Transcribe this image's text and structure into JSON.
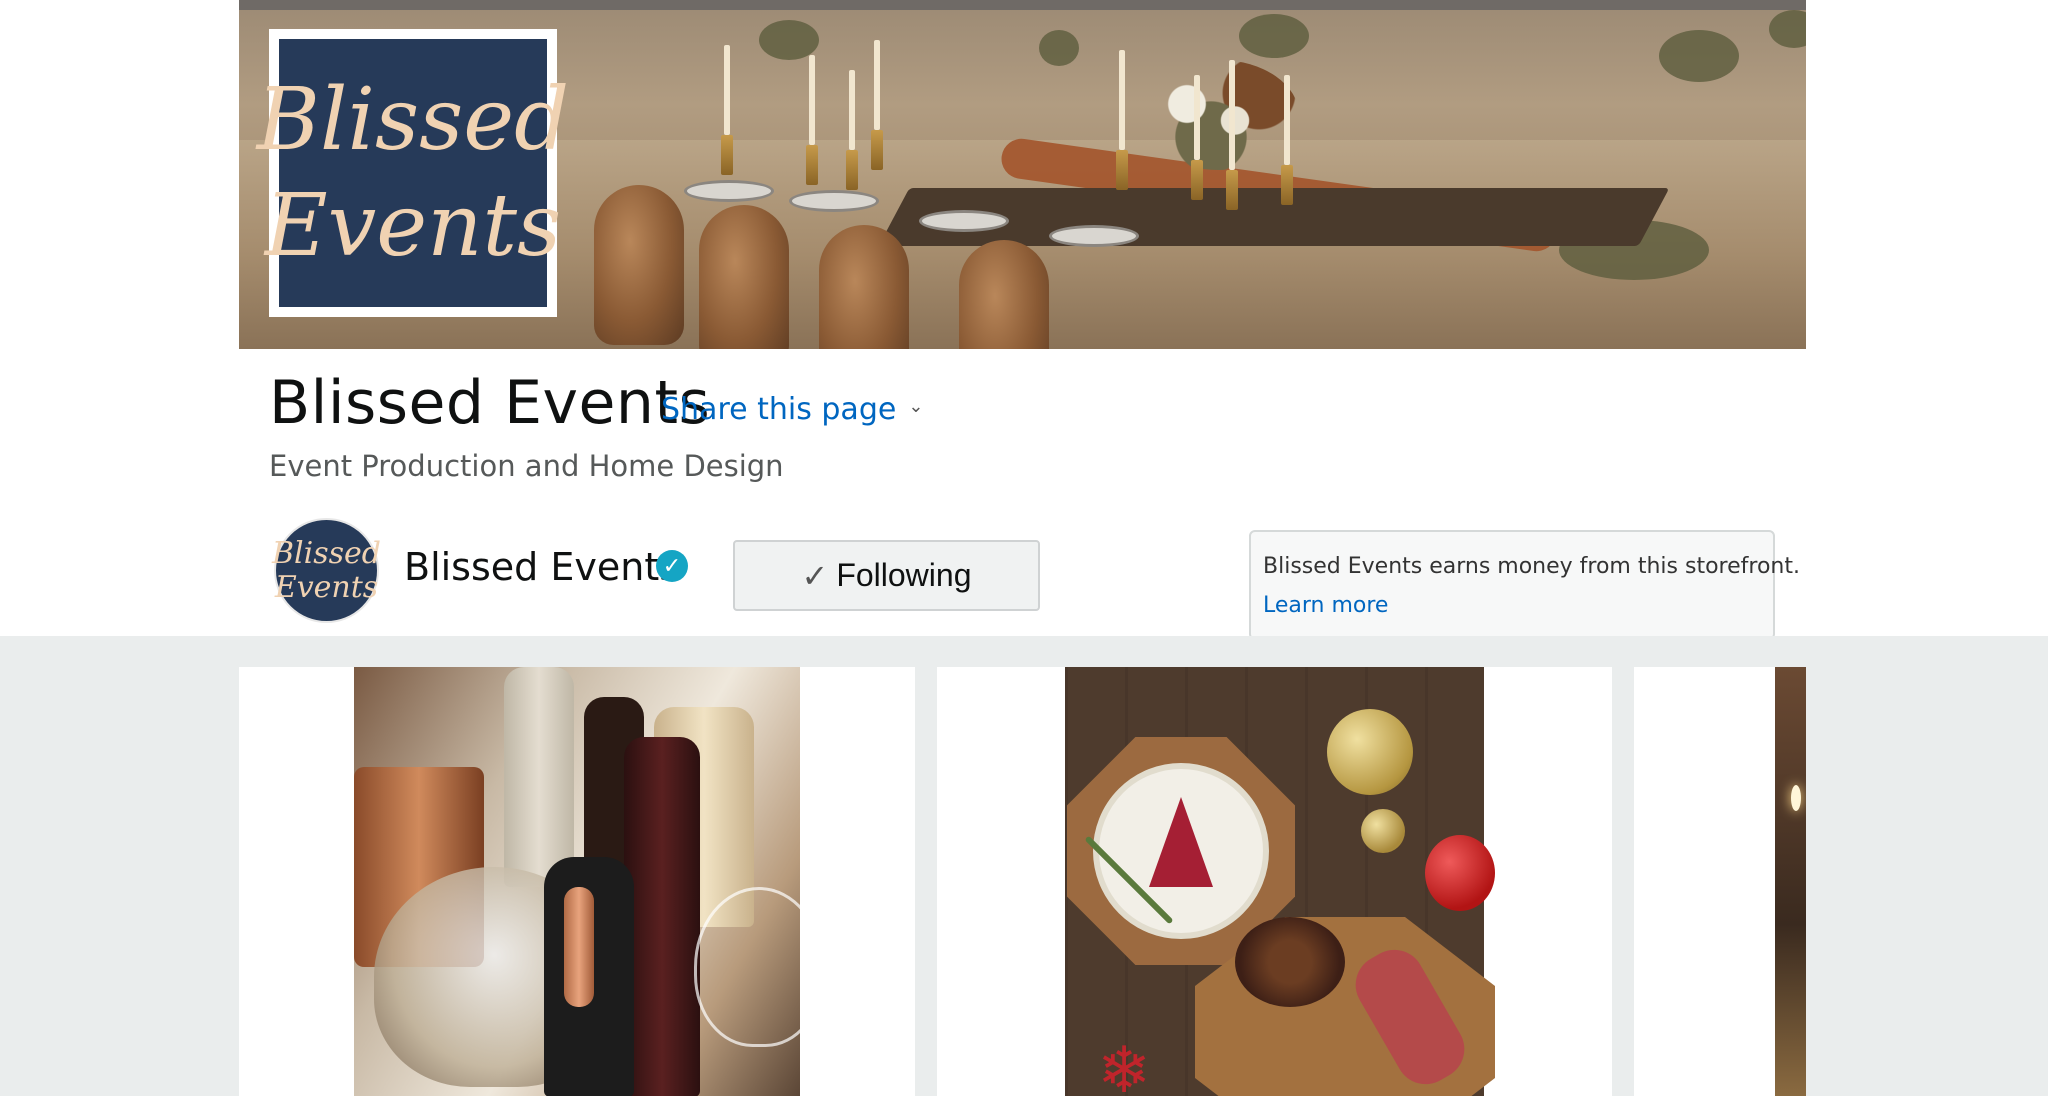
{
  "brand": {
    "logo_line1": "Blissed",
    "logo_line2": "Events",
    "logo_bg_color": "#263a59",
    "logo_text_color": "#f0d2b2"
  },
  "header": {
    "title": "Blissed Events",
    "share_label": "Share this page",
    "subtitle": "Event Production and Home Design"
  },
  "influencer": {
    "avatar_line1": "Blissed",
    "avatar_line2": "Events",
    "name": "Blissed Events",
    "verified_icon": "verified-check-icon",
    "following_label": "Following"
  },
  "disclosure": {
    "text": "Blissed Events earns money from this storefront.",
    "learn_more": "Learn more"
  },
  "colors": {
    "link": "#0066c0",
    "grid_background": "#eaeded",
    "verified": "#15a5c4"
  },
  "icons": {
    "share_chevron": "chevron-down-icon",
    "following_check": "checkmark-icon"
  },
  "cards": [
    {
      "id": "card-1",
      "image_subject": "wine bottles and cork bowl"
    },
    {
      "id": "card-2",
      "image_subject": "holiday charcuterie board"
    },
    {
      "id": "card-3",
      "image_subject": "candle table setting (partially visible)"
    }
  ]
}
